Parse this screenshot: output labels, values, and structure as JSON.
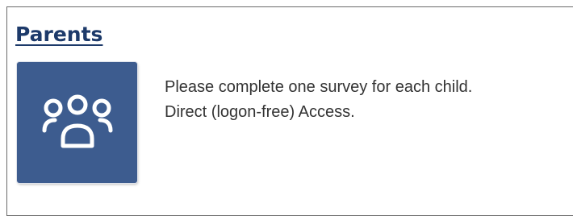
{
  "section": {
    "title": "Parents",
    "tile_icon": "group-of-people-icon",
    "tile_color": "#3d5c8f",
    "title_color": "#1d3a6a",
    "lines": [
      "Please complete one survey for each child.",
      "Direct (logon-free) Access."
    ]
  }
}
